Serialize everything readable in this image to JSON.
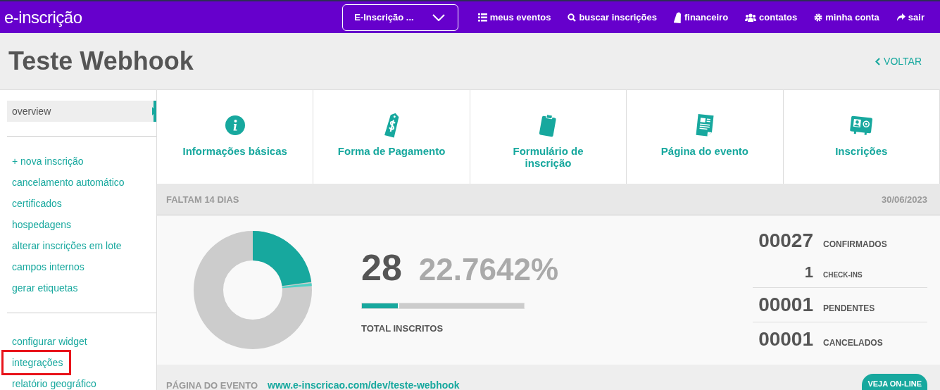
{
  "navbar": {
    "logo": "e-inscrição",
    "event_select": "E-Inscrição ...",
    "links": [
      {
        "label": "meus eventos"
      },
      {
        "label": "buscar inscrições"
      },
      {
        "label": "financeiro"
      },
      {
        "label": "contatos"
      },
      {
        "label": "minha conta"
      },
      {
        "label": "sair"
      }
    ]
  },
  "page": {
    "title": "Teste Webhook",
    "back": "VOLTAR"
  },
  "sidebar": {
    "groups": [
      [
        {
          "label": "overview",
          "selected": true,
          "highlighted": false
        }
      ],
      [
        {
          "label": "+ nova inscrição",
          "selected": false,
          "highlighted": false
        },
        {
          "label": "cancelamento automático",
          "selected": false,
          "highlighted": false
        },
        {
          "label": "certificados",
          "selected": false,
          "highlighted": false
        },
        {
          "label": "hospedagens",
          "selected": false,
          "highlighted": false
        },
        {
          "label": "alterar inscrições em lote",
          "selected": false,
          "highlighted": false
        },
        {
          "label": "campos internos",
          "selected": false,
          "highlighted": false
        },
        {
          "label": "gerar etiquetas",
          "selected": false,
          "highlighted": false
        }
      ],
      [
        {
          "label": "configurar widget",
          "selected": false,
          "highlighted": false
        },
        {
          "label": "integrações",
          "selected": false,
          "highlighted": true
        },
        {
          "label": "relatório geográfico",
          "selected": false,
          "highlighted": false
        }
      ]
    ]
  },
  "cards": [
    {
      "label": "Informações básicas"
    },
    {
      "label": "Forma de Pagamento"
    },
    {
      "label": "Formulário de inscrição"
    },
    {
      "label": "Página do evento"
    },
    {
      "label": "Inscrições"
    }
  ],
  "summary": {
    "countdown": "FALTAM 14 DIAS",
    "date": "30/06/2023",
    "total": "28",
    "percent": "22.7642%",
    "level": 0.22,
    "total_label": "TOTAL INSCRITOS",
    "stats": [
      {
        "value": "00027",
        "label": "CONFIRMADOS",
        "kind": "main"
      },
      {
        "value": "1",
        "label": "CHECK-INS",
        "kind": "sub"
      },
      {
        "value": "00001",
        "label": "PENDENTES",
        "kind": "main"
      },
      {
        "value": "00001",
        "label": "CANCELADOS",
        "kind": "main"
      }
    ]
  },
  "event_page": {
    "label": "PÁGINA DO EVENTO",
    "url": "www.e-inscricao.com/dev/teste-webhook",
    "button": "VEJA ON-LINE"
  }
}
